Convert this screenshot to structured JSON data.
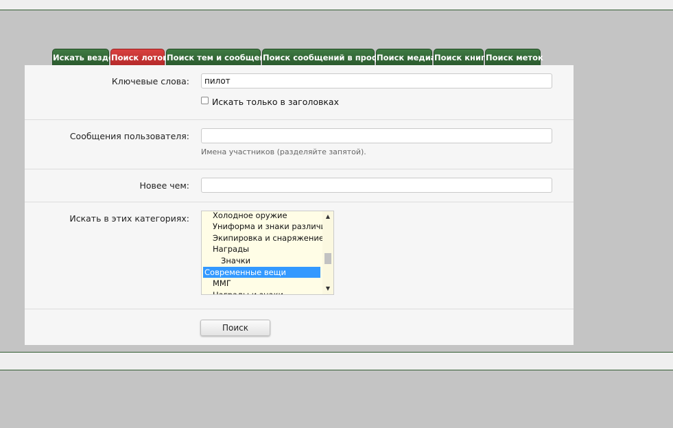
{
  "tabs": [
    {
      "label": "Искать везде",
      "active": false
    },
    {
      "label": "Поиск лотов",
      "active": true
    },
    {
      "label": "Поиск тем и сообщений",
      "active": false
    },
    {
      "label": "Поиск сообщений в профиле",
      "active": false
    },
    {
      "label": "Поиск медиа",
      "active": false
    },
    {
      "label": "Поиск книг",
      "active": false
    },
    {
      "label": "Поиск меток",
      "active": false
    }
  ],
  "form": {
    "keywords_label": "Ключевые слова:",
    "keywords_value": "пилот",
    "titles_only_label": "Искать только в заголовках",
    "titles_only_checked": false,
    "user_messages_label": "Сообщения пользователя:",
    "user_messages_value": "",
    "user_messages_hint": "Имена участников (разделяйте запятой).",
    "newer_than_label": "Новее чем:",
    "newer_than_value": "",
    "categories_label": "Искать в этих категориях:",
    "categories": [
      {
        "label": "Холодное оружие",
        "level": 1,
        "selected": false
      },
      {
        "label": "Униформа и знаки различия",
        "level": 1,
        "selected": false
      },
      {
        "label": "Экипировка и снаряжение",
        "level": 1,
        "selected": false
      },
      {
        "label": "Награды",
        "level": 1,
        "selected": false
      },
      {
        "label": "Значки",
        "level": 2,
        "selected": false
      },
      {
        "label": "Современные вещи",
        "level": 0,
        "selected": true
      },
      {
        "label": "ММГ",
        "level": 1,
        "selected": false
      },
      {
        "label": "Награды и знаки",
        "level": 1,
        "selected": false
      }
    ],
    "submit_label": "Поиск"
  },
  "colors": {
    "tab_green": "#2f6b33",
    "tab_active_red": "#c83434",
    "selection_blue": "#3399ff",
    "listbox_bg": "#fffde6"
  }
}
